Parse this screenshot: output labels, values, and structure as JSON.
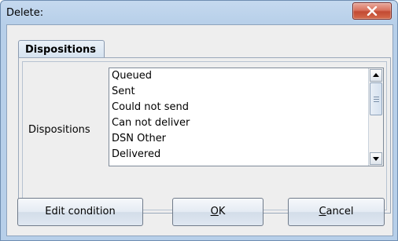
{
  "window": {
    "title": "Delete:"
  },
  "tabs": [
    {
      "label": "Dispositions"
    }
  ],
  "dispositions": {
    "label": "Dispositions",
    "items": [
      "Queued",
      "Sent",
      "Could not send",
      "Can not deliver",
      "DSN Other",
      "Delivered"
    ]
  },
  "buttons": {
    "edit_condition": "Edit condition",
    "ok": {
      "mnemonic": "O",
      "rest": "K"
    },
    "cancel": {
      "mnemonic": "C",
      "rest": "ancel"
    }
  }
}
